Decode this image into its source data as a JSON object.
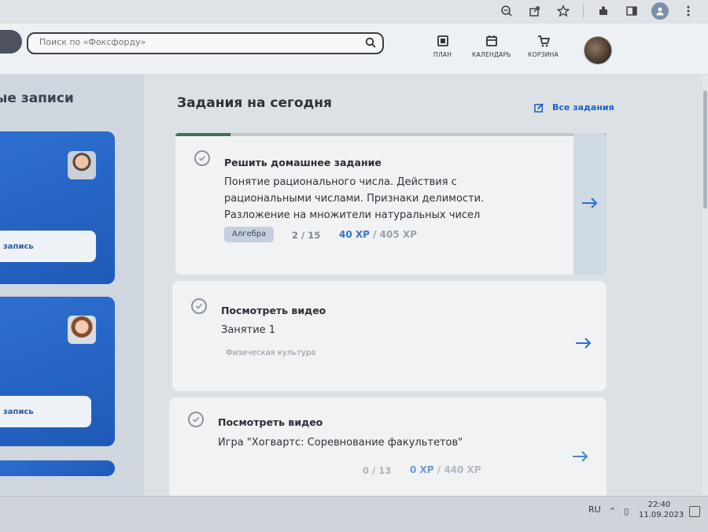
{
  "browser": {
    "icons": [
      "zoom-icon",
      "share-icon",
      "star-icon",
      "extensions-icon",
      "sidepanel-icon",
      "profile-icon",
      "menu-icon"
    ]
  },
  "header": {
    "search": {
      "placeholder": "Поиск по «Фоксфорду»"
    },
    "nav": [
      {
        "label": "ПЛАН",
        "icon": "plan-icon"
      },
      {
        "label": "КАЛЕНДАРЬ",
        "icon": "calendar-icon"
      },
      {
        "label": "КОРЗИНА",
        "icon": "cart-icon"
      }
    ]
  },
  "left": {
    "title": "ые записи",
    "cards": [
      {
        "button_label": "запись"
      },
      {
        "button_label": "запись"
      }
    ]
  },
  "main": {
    "title": "Задания на сегодня",
    "all_tasks_label": "Все задания",
    "tasks": [
      {
        "title": "Решить домашнее задание",
        "description": "Понятие рационального числа. Действия с рациональными числами. Признаки делимости. Разложение на множители натуральных чисел",
        "subject": "Алгебра",
        "progress": "2 / 15",
        "xp_earned": "40 XP",
        "xp_total": " / 405 XP"
      },
      {
        "title": "Посмотреть видео",
        "description": "Занятие 1",
        "subject": "Физическая культура"
      },
      {
        "title": "Посмотреть видео",
        "description": "Игра \"Хогвартс: Соревнование факультетов\"",
        "progress": "0 / 13",
        "xp_earned": "0 XP",
        "xp_total": " / 440 XP"
      }
    ]
  },
  "taskbar": {
    "language": "RU",
    "time": "22:40",
    "date": "11.09.2023"
  },
  "colors": {
    "accent": "#1e5ec4",
    "card_blue": "#2d6fd0",
    "progress_green": "#3f6f52"
  }
}
